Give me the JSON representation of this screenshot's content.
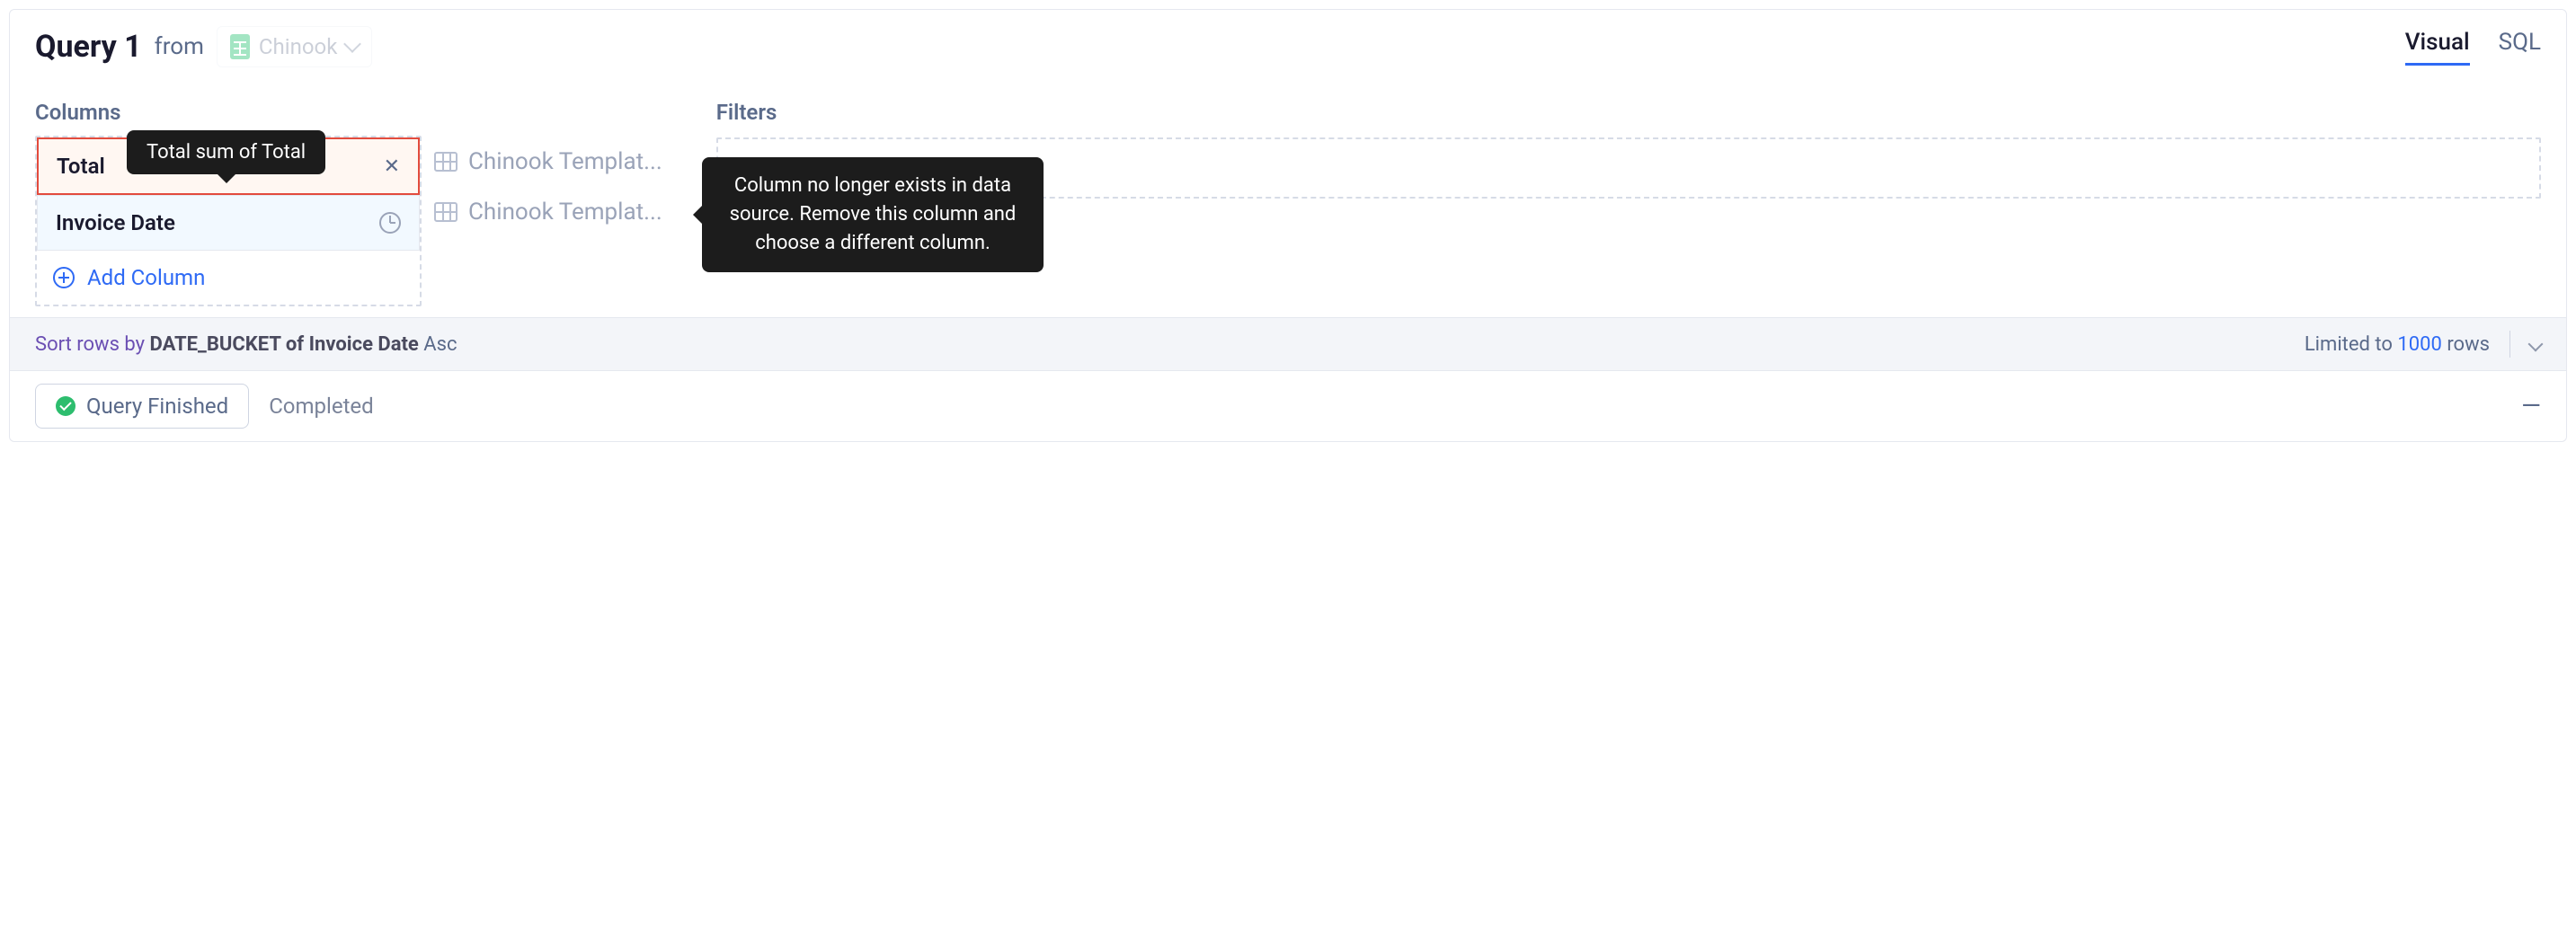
{
  "header": {
    "title": "Query 1",
    "from_label": "from",
    "source_name": "Chinook"
  },
  "tabs": {
    "visual": "Visual",
    "sql": "SQL",
    "active": "visual"
  },
  "columns": {
    "header": "Columns",
    "items": [
      {
        "label": "Total",
        "kind": "error",
        "template": "Chinook Templat..."
      },
      {
        "label": "Invoice Date",
        "kind": "date",
        "template": "Chinook Templat..."
      }
    ],
    "add_label": "Add Column"
  },
  "filters": {
    "header": "Filters"
  },
  "tooltips": {
    "column_hint": "Total sum of Total",
    "error_hint": "Column no longer exists in data source. Remove this column and choose a different column."
  },
  "sort": {
    "prefix": "Sort rows by ",
    "field": "DATE_BUCKET of Invoice Date",
    "direction": " Asc",
    "limited_prefix": "Limited to ",
    "limited_value": "1000",
    "limited_suffix": " rows"
  },
  "status": {
    "chip": "Query Finished",
    "text": "Completed"
  }
}
